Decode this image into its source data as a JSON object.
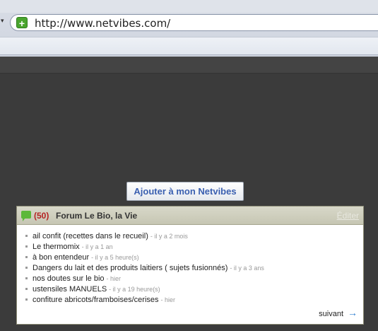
{
  "browser": {
    "url": "http://www.netvibes.com/",
    "dropdown_glyph": "▾",
    "site_icon_glyph": "+"
  },
  "page": {
    "add_button_label": "Ajouter à mon Netvibes"
  },
  "widget": {
    "count": "(50)",
    "title": "Forum Le Bio, la Vie",
    "edit_label": "Éditer",
    "next_label": "suivant",
    "next_icon": "→",
    "items": [
      {
        "title": "ail confit (recettes dans le recueil)",
        "time": "- il y a 2 mois"
      },
      {
        "title": "Le thermomix",
        "time": "- il y a 1 an"
      },
      {
        "title": "à bon entendeur",
        "time": "- il y a 5 heure(s)"
      },
      {
        "title": "Dangers du lait et des produits laitiers ( sujets fusionnés)",
        "time": "- il y a 3 ans"
      },
      {
        "title": "nos doutes sur le bio",
        "time": "- hier"
      },
      {
        "title": "ustensiles MANUELS",
        "time": "- il y a 19 heure(s)"
      },
      {
        "title": "confiture abricots/framboises/cerises",
        "time": "- hier"
      }
    ]
  }
}
